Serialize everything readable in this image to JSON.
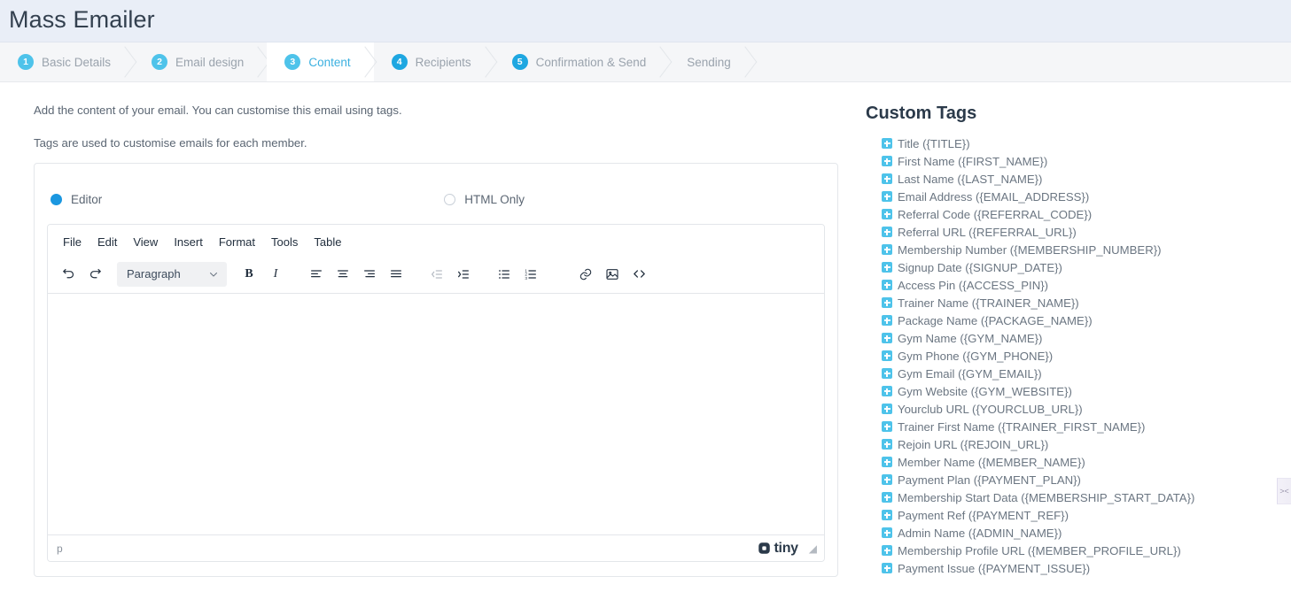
{
  "header": {
    "title": "Mass Emailer"
  },
  "wizard": {
    "steps": [
      {
        "num": "1",
        "label": "Basic Details",
        "state": "done"
      },
      {
        "num": "2",
        "label": "Email design",
        "state": "done"
      },
      {
        "num": "3",
        "label": "Content",
        "state": "active"
      },
      {
        "num": "4",
        "label": "Recipients",
        "state": "deep"
      },
      {
        "num": "5",
        "label": "Confirmation & Send",
        "state": "deep"
      },
      {
        "num": "",
        "label": "Sending",
        "state": "plain"
      }
    ]
  },
  "intro": {
    "line1": "Add the content of your email. You can customise this email using tags.",
    "line2": "Tags are used to customise emails for each member."
  },
  "mode": {
    "editor_label": "Editor",
    "html_label": "HTML Only",
    "selected": "Editor"
  },
  "editor": {
    "menus": [
      "File",
      "Edit",
      "View",
      "Insert",
      "Format",
      "Tools",
      "Table"
    ],
    "format_select": "Paragraph",
    "toolbar_icons": [
      "undo-icon",
      "redo-icon",
      "bold-icon",
      "italic-icon",
      "align-left-icon",
      "align-center-icon",
      "align-right-icon",
      "align-justify-icon",
      "outdent-icon",
      "indent-icon",
      "bullet-list-icon",
      "numbered-list-icon",
      "link-icon",
      "image-icon",
      "source-code-icon"
    ],
    "content": "",
    "status_path": "p",
    "brand": "tiny"
  },
  "tags": {
    "title": "Custom Tags",
    "items": [
      "Title ({TITLE})",
      "First Name ({FIRST_NAME})",
      "Last Name ({LAST_NAME})",
      "Email Address ({EMAIL_ADDRESS})",
      "Referral Code ({REFERRAL_CODE})",
      "Referral URL ({REFERRAL_URL})",
      "Membership Number ({MEMBERSHIP_NUMBER})",
      "Signup Date ({SIGNUP_DATE})",
      "Access Pin ({ACCESS_PIN})",
      "Trainer Name ({TRAINER_NAME})",
      "Package Name ({PACKAGE_NAME})",
      "Gym Name ({GYM_NAME})",
      "Gym Phone ({GYM_PHONE})",
      "Gym Email ({GYM_EMAIL})",
      "Gym Website ({GYM_WEBSITE})",
      "Yourclub URL ({YOURCLUB_URL})",
      "Trainer First Name ({TRAINER_FIRST_NAME})",
      "Rejoin URL ({REJOIN_URL})",
      "Member Name ({MEMBER_NAME})",
      "Payment Plan ({PAYMENT_PLAN})",
      "Membership Start Data ({MEMBERSHIP_START_DATA})",
      "Payment Ref ({PAYMENT_REF})",
      "Admin Name ({ADMIN_NAME})",
      "Membership Profile URL ({MEMBER_PROFILE_URL})",
      "Payment Issue ({PAYMENT_ISSUE})"
    ]
  },
  "edge": {
    "handle_glyph": "><"
  },
  "colors": {
    "accent": "#4ec3ea",
    "accent_deep": "#1ea7e1",
    "radio_on": "#1b97e0",
    "header_bg": "#e9eef7",
    "wizard_bg": "#f5f6f8",
    "text_muted": "#9aa3ad"
  }
}
